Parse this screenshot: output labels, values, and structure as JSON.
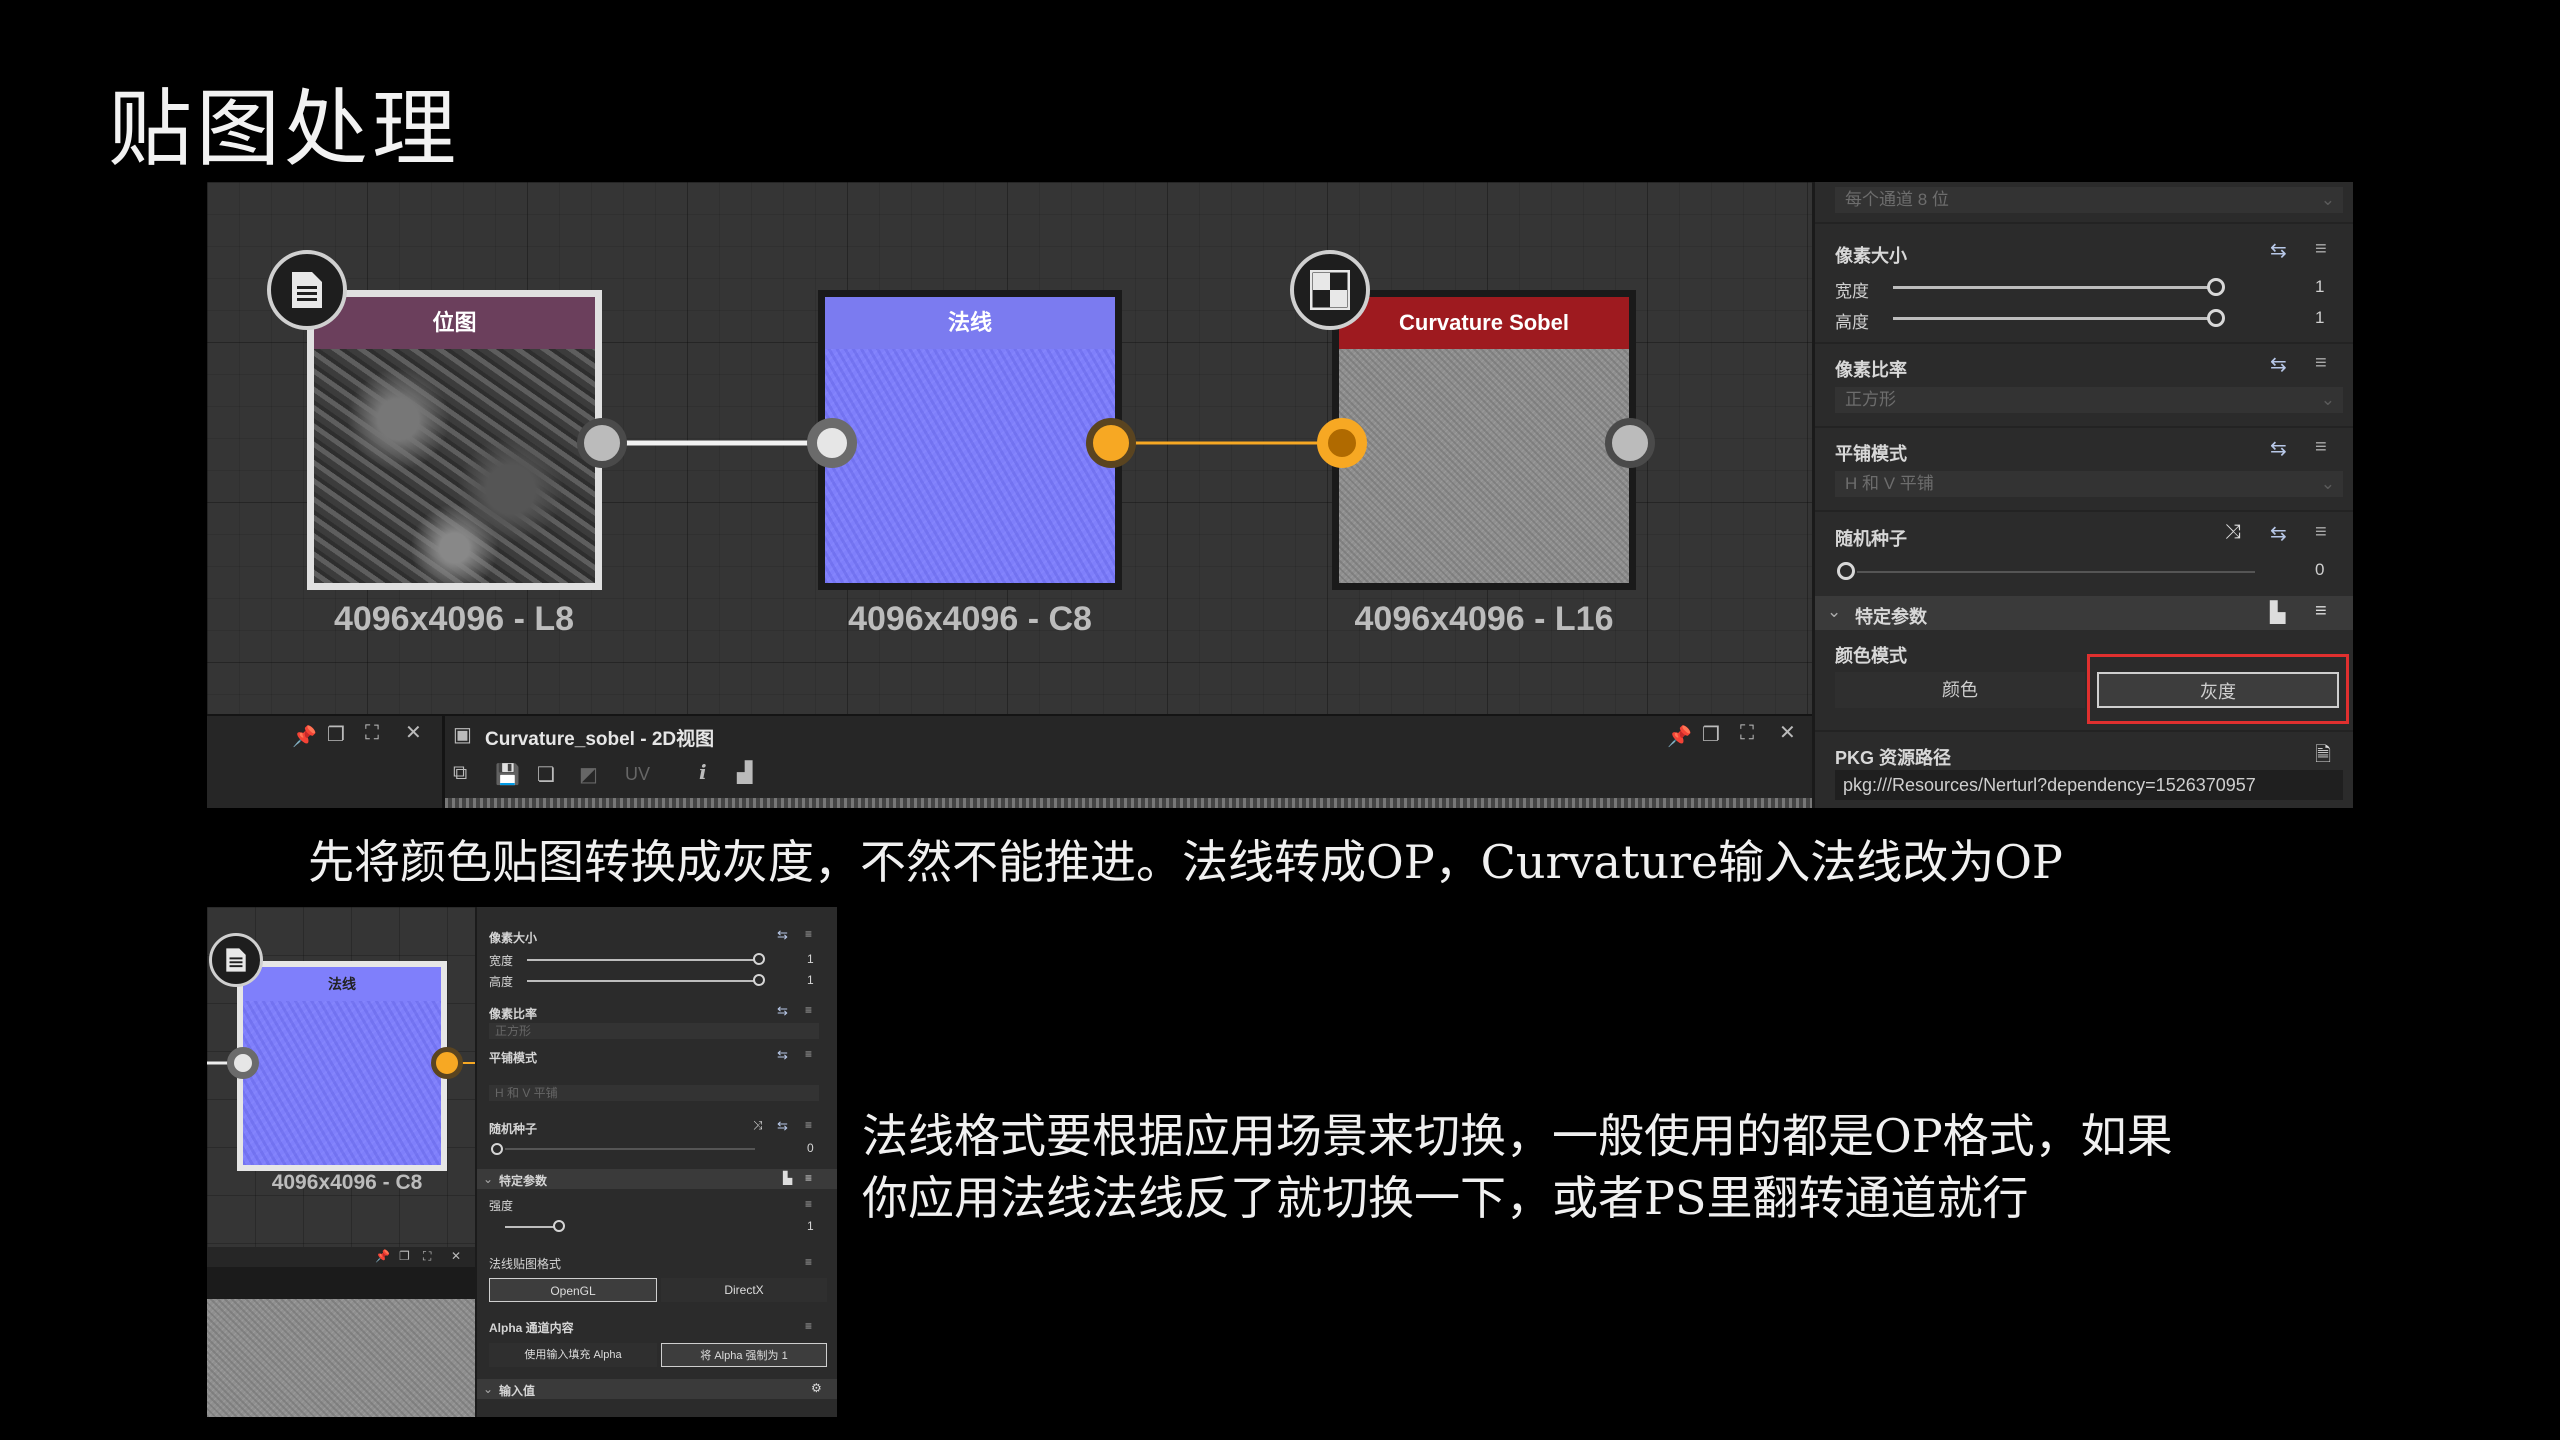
{
  "slide": {
    "title": "贴图处理",
    "caption1": "先将颜色贴图转换成灰度，不然不能推进。法线转成OP，Curvature输入法线改为OP",
    "caption2_line1": "法线格式要根据应用场景来切换，一般使用的都是OP格式，如果",
    "caption2_line2": "你应用法线法线反了就切换一下，或者PS里翻转通道就行"
  },
  "graph": {
    "nodes": [
      {
        "title": "位图",
        "size": "4096x4096 - L8",
        "header_color": "#6b3f5c"
      },
      {
        "title": "法线",
        "size": "4096x4096 - C8",
        "header_color": "#7b7bf0"
      },
      {
        "title": "Curvature Sobel",
        "size": "4096x4096 - L16",
        "header_color": "#9e1a1f"
      }
    ]
  },
  "panel": {
    "channel_dropdown": "每个通道 8 位",
    "pixel_size": {
      "label": "像素大小",
      "width_label": "宽度",
      "width_value": "1",
      "height_label": "高度",
      "height_value": "1"
    },
    "pixel_ratio": {
      "label": "像素比率",
      "value": "正方形"
    },
    "tiling": {
      "label": "平铺模式",
      "value": "H 和 V 平铺"
    },
    "seed": {
      "label": "随机种子",
      "value": "0"
    },
    "specific": {
      "label": "特定参数"
    },
    "color_mode": {
      "label": "颜色模式",
      "option_color": "颜色",
      "option_gray": "灰度",
      "selected": "灰度"
    },
    "pkg": {
      "label": "PKG 资源路径",
      "value": "pkg:///Resources/Nerturl?dependency=1526370957"
    }
  },
  "dock": {
    "title": "Curvature_sobel - 2D视图",
    "uv_label": "UV"
  },
  "small": {
    "node": {
      "title": "法线",
      "size": "4096x4096 - C8"
    },
    "pixel_size": {
      "label": "像素大小",
      "width_label": "宽度",
      "width_value": "1",
      "height_label": "高度",
      "height_value": "1"
    },
    "pixel_ratio": {
      "label": "像素比率",
      "value": "正方形"
    },
    "tiling": {
      "label": "平铺模式",
      "value": "H 和 V 平铺"
    },
    "seed": {
      "label": "随机种子",
      "value": "0"
    },
    "specific": "特定参数",
    "strength": {
      "label": "强度",
      "value": "1"
    },
    "normal_format": {
      "label": "法线贴图格式",
      "opengl": "OpenGL",
      "directx": "DirectX"
    },
    "alpha": {
      "label": "Alpha 通道内容",
      "opt1": "使用输入填充 Alpha",
      "opt2": "将 Alpha 强制为 1"
    },
    "input_value": "输入值"
  },
  "colors": {
    "accent_orange": "#f7a823",
    "highlight_red": "#e0302f",
    "panel_bg": "#2b2b2b"
  }
}
